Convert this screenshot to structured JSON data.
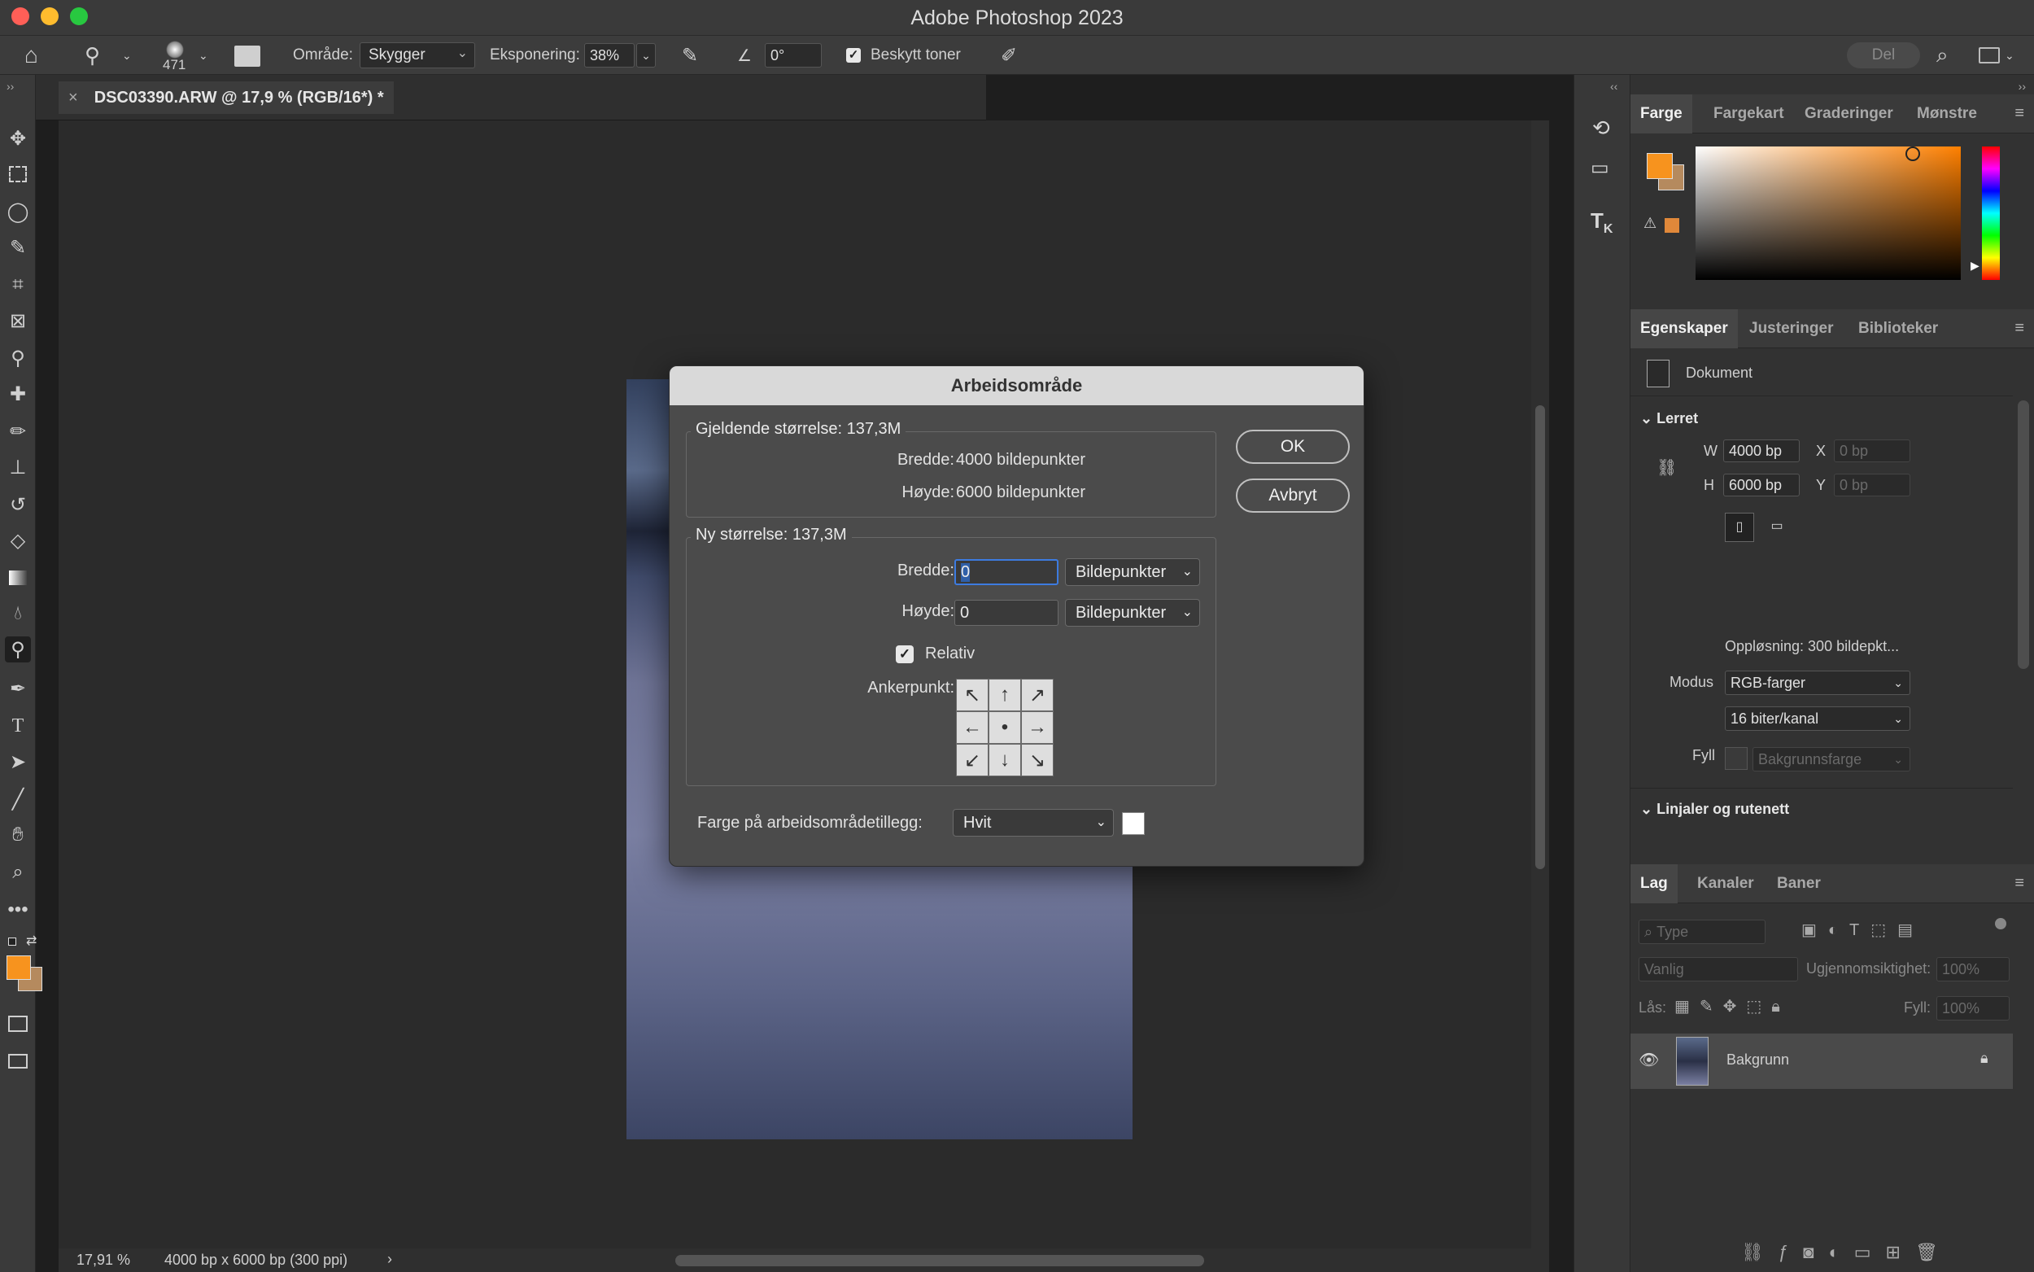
{
  "window": {
    "title": "Adobe Photoshop 2023"
  },
  "options_bar": {
    "brush_size": "471",
    "range_label": "Område:",
    "range_value": "Skygger",
    "exposure_label": "Eksponering:",
    "exposure_value": "38%",
    "angle_value": "0°",
    "protect_tones_label": "Beskytt toner",
    "share_label": "Del"
  },
  "document": {
    "tab_title": "DSC03390.ARW @ 17,9 % (RGB/16*) *",
    "zoom": "17,91 %",
    "doc_info": "4000 bp x 6000 bp (300 ppi)"
  },
  "color_panel": {
    "tabs": [
      "Farge",
      "Fargekart",
      "Graderinger",
      "Mønstre"
    ],
    "foreground": "#f7931e",
    "background": "#b58a5e"
  },
  "properties_panel": {
    "tabs": [
      "Egenskaper",
      "Justeringer",
      "Biblioteker"
    ],
    "doc_label": "Dokument",
    "canvas_section": "Lerret",
    "w_label": "W",
    "w_value": "4000 bp",
    "h_label": "H",
    "h_value": "6000 bp",
    "x_label": "X",
    "x_value": "0 bp",
    "y_label": "Y",
    "y_value": "0 bp",
    "resolution": "Oppløsning: 300 bildepkt...",
    "mode_label": "Modus",
    "mode_value": "RGB-farger",
    "depth_value": "16 biter/kanal",
    "fill_label": "Fyll",
    "fill_value": "Bakgrunnsfarge",
    "rulers_section": "Linjaler og rutenett"
  },
  "layers_panel": {
    "tabs": [
      "Lag",
      "Kanaler",
      "Baner"
    ],
    "filter_placeholder": "Type",
    "blend_mode": "Vanlig",
    "opacity_label": "Ugjennomsiktighet:",
    "opacity_value": "100%",
    "lock_label": "Lås:",
    "fill_label": "Fyll:",
    "fill_value": "100%",
    "layers": [
      {
        "name": "Bakgrunn"
      }
    ]
  },
  "dialog": {
    "title": "Arbeidsområde",
    "current_size_label": "Gjeldende størrelse: 137,3M",
    "width_label": "Bredde:",
    "width_value": "4000 bildepunkter",
    "height_label": "Høyde:",
    "height_value": "6000 bildepunkter",
    "new_size_label": "Ny størrelse: 137,3M",
    "new_width_value": "0",
    "new_height_value": "0",
    "unit_value": "Bildepunkter",
    "relative_label": "Relativ",
    "anchor_label": "Ankerpunkt:",
    "extension_color_label": "Farge på arbeidsområdetillegg:",
    "extension_color_value": "Hvit",
    "ok_label": "OK",
    "cancel_label": "Avbryt"
  }
}
